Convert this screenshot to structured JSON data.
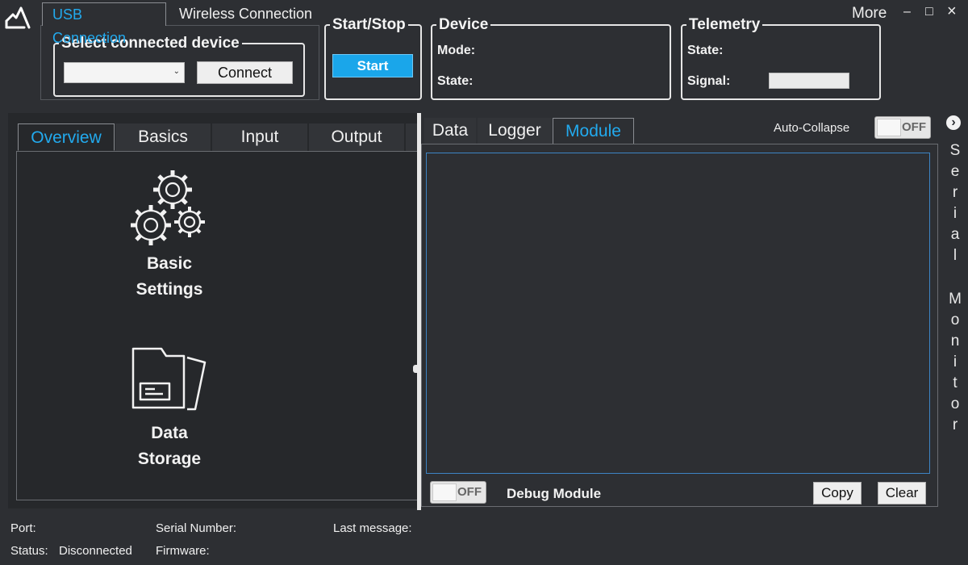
{
  "connection_tabs": [
    "USB Connection",
    "Wireless Connection"
  ],
  "select_device": {
    "legend": "Select connected device",
    "selected": "",
    "connect_label": "Connect"
  },
  "start_stop": {
    "legend": "Start/Stop",
    "button_label": "Start"
  },
  "device": {
    "legend": "Device",
    "mode_label": "Mode:",
    "state_label": "State:"
  },
  "telemetry": {
    "legend": "Telemetry",
    "state_label": "State:",
    "signal_label": "Signal:"
  },
  "window": {
    "more_label": "More",
    "minimize": "–",
    "maximize": "□",
    "close": "×"
  },
  "left_tabs": [
    "Overview",
    "Basics",
    "Input",
    "Output"
  ],
  "overview_items": [
    {
      "line1": "Basic",
      "line2": "Settings",
      "icon": "gears-icon"
    },
    {
      "line1": "Data",
      "line2": "Storage",
      "icon": "folder-icon"
    }
  ],
  "right_tabs": [
    "Data",
    "Logger",
    "Module"
  ],
  "auto_collapse": {
    "label": "Auto-Collapse",
    "state": "OFF"
  },
  "debug": {
    "label": "Debug Module",
    "state": "OFF"
  },
  "actions": {
    "copy": "Copy",
    "clear": "Clear"
  },
  "side_panel": {
    "title_chars": [
      "S",
      "e",
      "r",
      "i",
      "a",
      "l",
      "",
      "M",
      "o",
      "n",
      "i",
      "t",
      "o",
      "r"
    ],
    "arrow": "›"
  },
  "status_bar": {
    "port_label": "Port:",
    "serial_label": "Serial Number:",
    "last_message_label": "Last message:",
    "status_label": "Status:",
    "status_value": "Disconnected",
    "firmware_label": "Firmware:"
  },
  "colors": {
    "accent": "#22aaee",
    "start_button": "#1aa6ea",
    "background": "#2d2f33"
  }
}
